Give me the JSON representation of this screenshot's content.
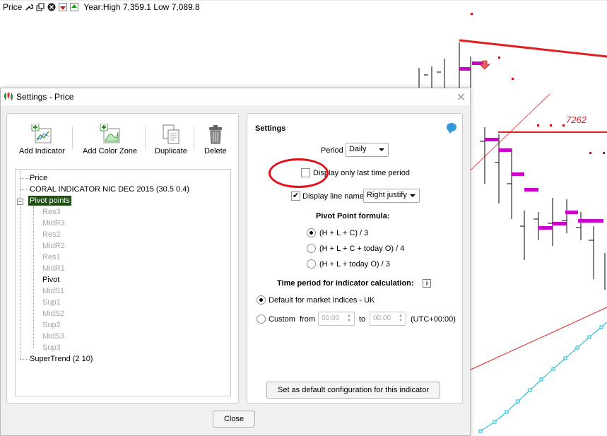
{
  "chart": {
    "instrument_label": "Price",
    "range_text": "Year:High 7,359.1 Low 7,089.8",
    "annotation_level": "7262",
    "colors": {
      "trend_line": "#e02020",
      "pivot_marker": "#cc00cc",
      "supertrend": "#00bcd4",
      "bars": "#000000"
    }
  },
  "dialog": {
    "title": "Settings - Price",
    "close_label": "Close",
    "toolbar": {
      "add_indicator": "Add Indicator",
      "add_color_zone": "Add Color Zone",
      "duplicate": "Duplicate",
      "delete": "Delete"
    },
    "tree": {
      "items": [
        {
          "label": "Price",
          "state": "normal"
        },
        {
          "label": "CORAL INDICATOR NIC DEC 2015 (30.5 0.4)",
          "state": "normal"
        },
        {
          "label": "Pivot points",
          "state": "selected"
        },
        {
          "label": "Res3",
          "state": "disabled"
        },
        {
          "label": "MidR3",
          "state": "disabled"
        },
        {
          "label": "Res2",
          "state": "disabled"
        },
        {
          "label": "MidR2",
          "state": "disabled"
        },
        {
          "label": "Res1",
          "state": "disabled"
        },
        {
          "label": "MidR1",
          "state": "disabled"
        },
        {
          "label": "Pivot",
          "state": "normal"
        },
        {
          "label": "MidS1",
          "state": "disabled"
        },
        {
          "label": "Sup1",
          "state": "disabled"
        },
        {
          "label": "MidS2",
          "state": "disabled"
        },
        {
          "label": "Sup2",
          "state": "disabled"
        },
        {
          "label": "MidS3",
          "state": "disabled"
        },
        {
          "label": "Sup3",
          "state": "disabled"
        },
        {
          "label": "SuperTrend (2 10)",
          "state": "normal"
        }
      ]
    },
    "settings": {
      "heading": "Settings",
      "period_label": "Period",
      "period_value": "Daily",
      "last_period_label": "Display only last time period",
      "last_period_checked": false,
      "line_name_label": "Display line name",
      "line_name_checked": true,
      "line_name_value": "Right justify",
      "formula_title": "Pivot Point formula:",
      "formulas": [
        "(H + L + C) / 3",
        "(H + L + C + today O) / 4",
        "(H + L + today O) / 3"
      ],
      "formula_selected": 0,
      "time_period_title": "Time period for indicator calculation:",
      "default_option": "Default for market Indices - UK",
      "custom_option": "Custom",
      "from_label": "from",
      "to_label": "to",
      "from_value": "00:00",
      "to_value": "00:00",
      "timezone": "(UTC+00:00)",
      "time_selected": "default",
      "set_default_button": "Set as default configuration for this indicator"
    }
  }
}
